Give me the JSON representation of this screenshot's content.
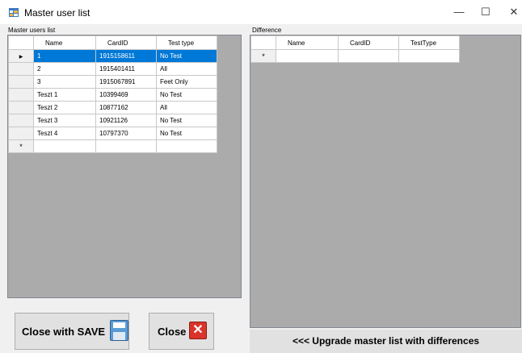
{
  "window": {
    "title": "Master user list",
    "minimize_glyph": "—",
    "maximize_glyph": "☐",
    "close_glyph": "✕"
  },
  "left": {
    "group_label": "Master users list",
    "columns": [
      "Name",
      "CardID",
      "Test type"
    ],
    "rows": [
      {
        "name": "1",
        "card": "1915158611",
        "test": "No Test",
        "selected": true
      },
      {
        "name": "2",
        "card": "1915401411",
        "test": "All"
      },
      {
        "name": "3",
        "card": "1915067891",
        "test": "Feet Only"
      },
      {
        "name": "Teszt 1",
        "card": "10399469",
        "test": "No Test"
      },
      {
        "name": "Teszt 2",
        "card": "10877162",
        "test": "All"
      },
      {
        "name": "Teszt 3",
        "card": "10921126",
        "test": "No Test"
      },
      {
        "name": "Teszt 4",
        "card": "10797370",
        "test": "No Test"
      }
    ],
    "new_row_marker": "*",
    "current_row_marker": "▶"
  },
  "right": {
    "group_label": "Difference",
    "columns": [
      "Name",
      "CardID",
      "TestType"
    ],
    "new_row_marker": "*"
  },
  "buttons": {
    "close_save": "Close with SAVE",
    "close": "Close",
    "close_icon_glyph": "✕",
    "upgrade": "<<< Upgrade master list with differences"
  },
  "icons": {
    "app": "grid-window-icon",
    "save": "floppy-disk-icon",
    "close": "red-x-icon"
  }
}
